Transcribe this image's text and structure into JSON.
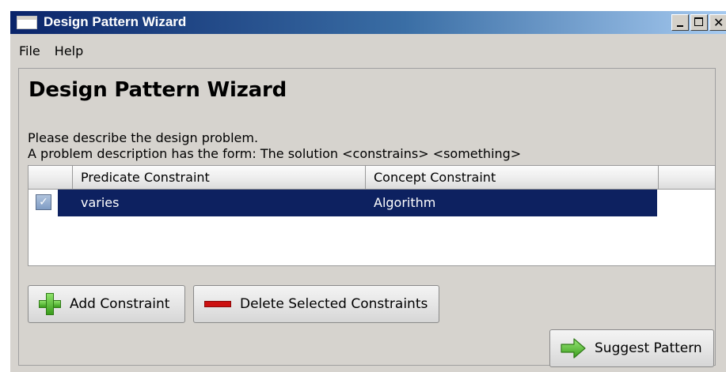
{
  "window": {
    "title": "Design Pattern Wizard",
    "controls": {
      "minimize": "minimize-icon",
      "maximize": "maximize-icon",
      "close": "close-icon"
    }
  },
  "menu": {
    "items": [
      "File",
      "Help"
    ]
  },
  "main": {
    "heading": "Design Pattern Wizard",
    "description_line1": "Please describe the design problem.",
    "description_line2": "A problem description has the form: The solution <constrains> <something>"
  },
  "table": {
    "columns": [
      "",
      "Predicate Constraint",
      "Concept Constraint"
    ],
    "rows": [
      {
        "checked": true,
        "predicate": "varies",
        "concept": "Algorithm",
        "selected": true
      }
    ],
    "selection_color": "#0d2160"
  },
  "buttons": {
    "add": {
      "label": "Add Constraint",
      "icon": "plus-icon",
      "color": "#4cbb2a"
    },
    "delete": {
      "label": "Delete Selected Constraints",
      "icon": "minus-icon",
      "color": "#cc1010"
    },
    "suggest": {
      "label": "Suggest Pattern",
      "icon": "arrow-right-icon",
      "color": "#4cbb2a"
    }
  }
}
